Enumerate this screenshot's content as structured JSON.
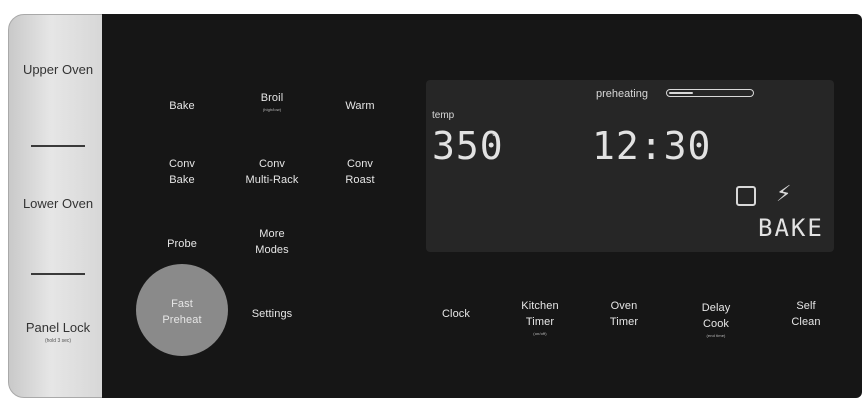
{
  "side_panel": {
    "upper_oven": [
      "Upper",
      "Oven"
    ],
    "lower_oven": [
      "Lower",
      "Oven"
    ],
    "panel_lock": [
      "Panel",
      "Lock"
    ],
    "panel_lock_sub": "(hold 3 sec)"
  },
  "keys": {
    "bake": "Bake",
    "broil": "Broil",
    "broil_sub": "(high/low)",
    "warm": "Warm",
    "conv_bake": [
      "Conv",
      "Bake"
    ],
    "conv_multi_rack": [
      "Conv",
      "Multi-Rack"
    ],
    "conv_roast": [
      "Conv",
      "Roast"
    ],
    "probe": "Probe",
    "more_modes": [
      "More",
      "Modes"
    ],
    "fast_preheat": [
      "Fast",
      "Preheat"
    ],
    "settings": "Settings",
    "clock": "Clock",
    "kitchen_timer": [
      "Kitchen",
      "Timer"
    ],
    "kitchen_timer_sub": "(on/off)",
    "oven_timer": [
      "Oven",
      "Timer"
    ],
    "delay_cook": [
      "Delay",
      "Cook"
    ],
    "delay_cook_sub": "(end time)",
    "self_clean": [
      "Self",
      "Clean"
    ]
  },
  "display": {
    "preheating_label": "preheating",
    "preheat_progress": 0.3,
    "temp_label": "temp",
    "temperature": "350",
    "degree_mark": "°",
    "clock": "12:30",
    "mode": "BAKE"
  },
  "icons": {
    "door": "door-lock-icon",
    "lightning": "lightning-icon"
  }
}
